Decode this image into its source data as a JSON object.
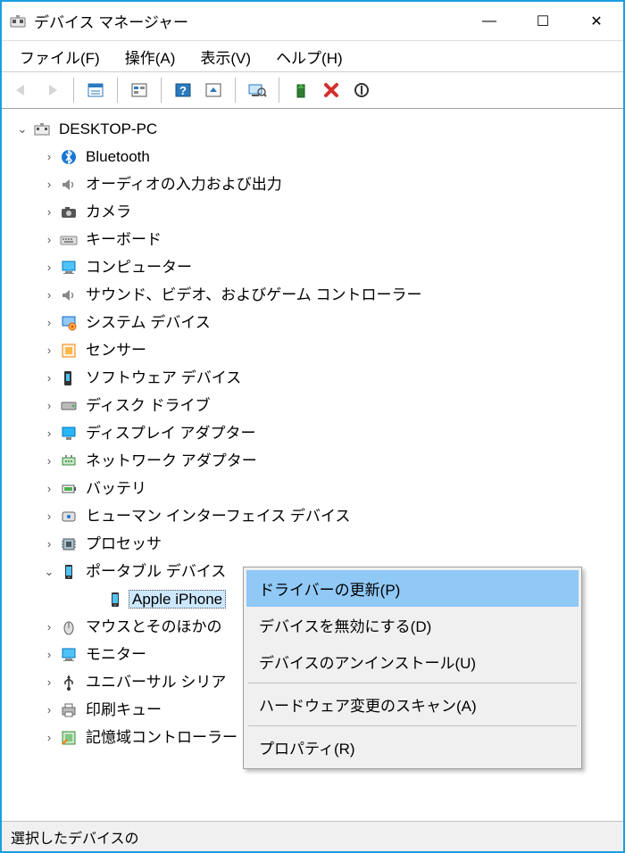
{
  "title": "デバイス マネージャー",
  "winbtns": {
    "min": "—",
    "max": "☐",
    "close": "✕"
  },
  "menu": {
    "file": "ファイル(F)",
    "action": "操作(A)",
    "view": "表示(V)",
    "help": "ヘルプ(H)"
  },
  "toolbar_icons": [
    "back-icon",
    "forward-icon",
    "sep",
    "properties-icon",
    "devices-icon",
    "sep",
    "help-icon",
    "show-hidden-icon",
    "sep",
    "scan-hardware-icon",
    "sep",
    "update-driver-icon",
    "uninstall-icon",
    "disable-icon"
  ],
  "root": {
    "label": "DESKTOP-PC",
    "expanded": true
  },
  "categories": [
    {
      "icon": "bluetooth",
      "label": "Bluetooth"
    },
    {
      "icon": "audio",
      "label": "オーディオの入力および出力"
    },
    {
      "icon": "camera",
      "label": "カメラ"
    },
    {
      "icon": "keyboard",
      "label": "キーボード"
    },
    {
      "icon": "computer",
      "label": "コンピューター"
    },
    {
      "icon": "sound",
      "label": "サウンド、ビデオ、およびゲーム コントローラー"
    },
    {
      "icon": "system",
      "label": "システム デバイス"
    },
    {
      "icon": "sensor",
      "label": "センサー"
    },
    {
      "icon": "software",
      "label": "ソフトウェア デバイス"
    },
    {
      "icon": "disk",
      "label": "ディスク ドライブ"
    },
    {
      "icon": "display",
      "label": "ディスプレイ アダプター"
    },
    {
      "icon": "network",
      "label": "ネットワーク アダプター"
    },
    {
      "icon": "battery",
      "label": "バッテリ"
    },
    {
      "icon": "hid",
      "label": "ヒューマン インターフェイス デバイス"
    },
    {
      "icon": "cpu",
      "label": "プロセッサ"
    },
    {
      "icon": "portable",
      "label": "ポータブル デバイス",
      "expanded": true,
      "children": [
        {
          "icon": "portable-device",
          "label": "Apple iPhone",
          "selected": true
        }
      ]
    },
    {
      "icon": "mouse",
      "label": "マウスとそのほかの"
    },
    {
      "icon": "monitor",
      "label": "モニター"
    },
    {
      "icon": "usb",
      "label": "ユニバーサル シリア"
    },
    {
      "icon": "printer",
      "label": "印刷キュー"
    },
    {
      "icon": "storage",
      "label": "記憶域コントローラー"
    }
  ],
  "context_menu": {
    "update": "ドライバーの更新(P)",
    "disable": "デバイスを無効にする(D)",
    "uninstall": "デバイスのアンインストール(U)",
    "scan": "ハードウェア変更のスキャン(A)",
    "properties": "プロパティ(R)"
  },
  "statusbar": "選択したデバイスの"
}
